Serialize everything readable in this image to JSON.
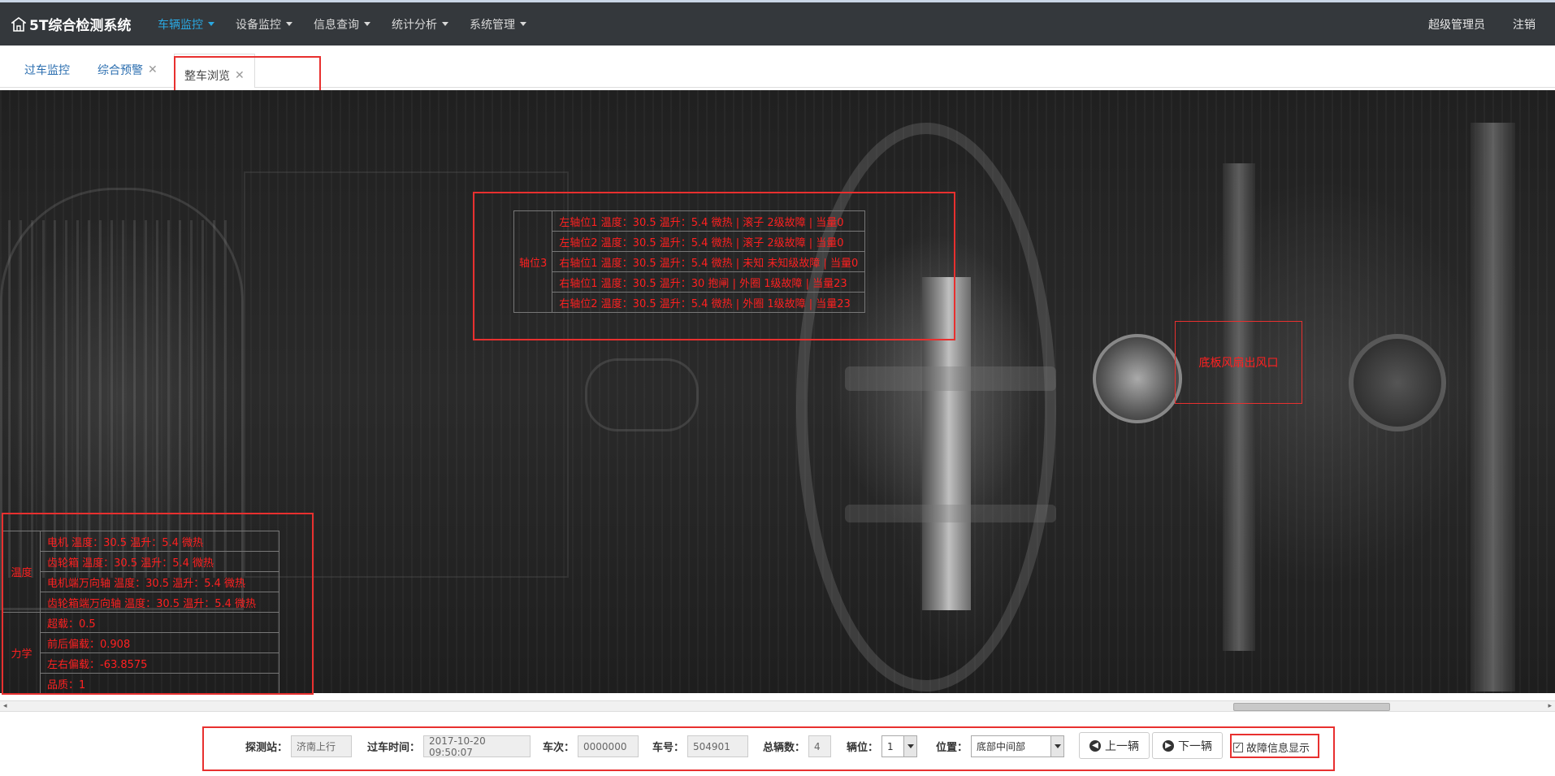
{
  "brand": {
    "title": "5T综合检测系统",
    "icon": "home-icon"
  },
  "nav": {
    "items": [
      {
        "label": "车辆监控",
        "active": true
      },
      {
        "label": "设备监控"
      },
      {
        "label": "信息查询"
      },
      {
        "label": "统计分析"
      },
      {
        "label": "系统管理"
      }
    ],
    "user": "超级管理员",
    "logout": "注销"
  },
  "tabs": [
    {
      "label": "过车监控",
      "closable": false
    },
    {
      "label": "综合预警",
      "closable": true
    },
    {
      "label": "整车浏览",
      "closable": true,
      "active": true
    }
  ],
  "axle_info": {
    "group": "轴位3",
    "rows": [
      "左轴位1 温度：30.5 温升：5.4 微热 | 滚子 2级故障 | 当量0",
      "左轴位2 温度：30.5 温升：5.4 微热 | 滚子 2级故障 | 当量0",
      "右轴位1 温度：30.5 温升：5.4 微热 | 未知 未知级故障 | 当量0",
      "右轴位1 温度：30.5 温升：30 抱闸 | 外圈 1级故障 | 当量23",
      "右轴位2 温度：30.5 温升：5.4 微热 | 外圈 1级故障 | 当量23"
    ]
  },
  "fan_label": "底板风扇出风口",
  "bottom_info": {
    "temp_group": "温度",
    "temp_rows": [
      "电机 温度：30.5 温升：5.4 微热",
      "齿轮箱 温度：30.5 温升：5.4 微热",
      "电机端万向轴 温度：30.5 温升：5.4 微热",
      "齿轮箱端万向轴 温度：30.5 温升：5.4 微热"
    ],
    "mech_group": "力学",
    "mech_rows": [
      "超载：0.5",
      "前后偏载：0.908",
      "左右偏载：-63.8575",
      "品质：1"
    ]
  },
  "controls": {
    "station_label": "探测站：",
    "station_value": "济南上行",
    "time_label": "过车时间：",
    "time_value": "2017-10-20 09:50:07",
    "train_label": "车次：",
    "train_value": "0000000",
    "car_label": "车号：",
    "car_value": "504901",
    "total_label": "总辆数：",
    "total_value": "4",
    "pos_label": "辆位：",
    "pos_value": "1",
    "location_label": "位置：",
    "location_value": "底部中间部",
    "prev_label": "上一辆",
    "next_label": "下一辆",
    "fault_label": "故障信息显示",
    "fault_checked": true
  },
  "colors": {
    "nav_bg": "#34383c",
    "accent": "#2aa7e0",
    "alert_red": "#e8302f",
    "info_text": "#ff2020"
  }
}
